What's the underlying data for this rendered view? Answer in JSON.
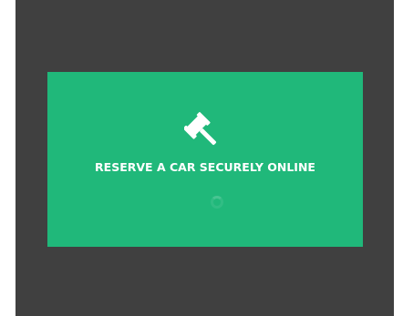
{
  "banner": {
    "headline": "RESERVE A CAR SECURELY ONLINE",
    "icon": "gavel-icon",
    "background_color": "#20b87a",
    "frame_color": "#404040",
    "text_color": "#ffffff"
  }
}
